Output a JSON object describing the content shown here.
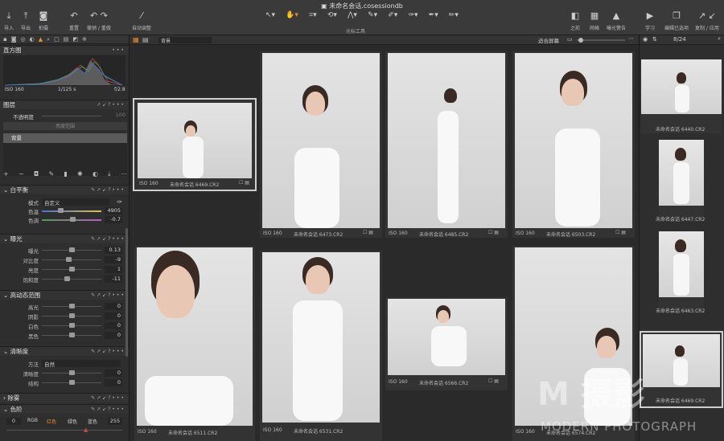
{
  "window": {
    "title": "未命名会话.cosessiondb"
  },
  "toolbar": {
    "import": "导入",
    "export": "导出",
    "capture": "拍摄",
    "reset": "重置",
    "undo_redo": "撤销 / 重做",
    "auto_adjust": "自动调整",
    "cursor_tools": "光标工具",
    "before": "之前",
    "grid": "网格",
    "exposure_warning": "曝光警告",
    "learn": "学习",
    "edit_selected": "编辑已选项",
    "copy_apply": "复制 / 应用"
  },
  "viewer": {
    "layer_select": "背景",
    "fit": "适合屏幕",
    "counter": "8/24"
  },
  "histogram": {
    "title": "直方图",
    "iso": "ISO 160",
    "shutter": "1/125 s",
    "aperture": "f/2.8"
  },
  "layers": {
    "title": "图层",
    "opacity_label": "不透明度",
    "opacity_value": "100",
    "mask_label": "亮度范围",
    "background_layer": "背景"
  },
  "white_balance": {
    "title": "白平衡",
    "mode_label": "模式",
    "mode_value": "自定义",
    "rows": [
      {
        "label": "色温",
        "value": "4905"
      },
      {
        "label": "色调",
        "value": "-0.7"
      }
    ]
  },
  "exposure": {
    "title": "曝光",
    "rows": [
      {
        "label": "曝光",
        "value": "0.13"
      },
      {
        "label": "对比度",
        "value": "-9"
      },
      {
        "label": "亮度",
        "value": "1"
      },
      {
        "label": "饱和度",
        "value": "-11"
      }
    ]
  },
  "hdr": {
    "title": "高动态范围",
    "rows": [
      {
        "label": "高光",
        "value": "0"
      },
      {
        "label": "阴影",
        "value": "0"
      },
      {
        "label": "白色",
        "value": "0"
      },
      {
        "label": "黑色",
        "value": "0"
      }
    ]
  },
  "clarity": {
    "title": "清晰度",
    "method_label": "方法",
    "method_value": "自然",
    "rows": [
      {
        "label": "清晰度",
        "value": "0"
      },
      {
        "label": "结构",
        "value": "0"
      }
    ]
  },
  "dehaze": {
    "title": "除雾"
  },
  "levels": {
    "title": "色阶",
    "low": "0",
    "high": "255",
    "channels": [
      "RGB",
      "红色",
      "绿色",
      "蓝色"
    ]
  },
  "thumbnails": [
    {
      "iso": "ISO 160",
      "name": "未命名会话 6469.CR2"
    },
    {
      "iso": "ISO 160",
      "name": "未命名会话 6473.CR2"
    },
    {
      "iso": "ISO 160",
      "name": "未命名会话 6485.CR2"
    },
    {
      "iso": "ISO 160",
      "name": "未命名会话 6503.CR2"
    },
    {
      "iso": "ISO 160",
      "name": "未命名会话 6511.CR2"
    },
    {
      "iso": "ISO 160",
      "name": "未命名会话 6531.CR2"
    },
    {
      "iso": "ISO 160",
      "name": "未命名会话 6566.CR2"
    },
    {
      "iso": "ISO 160",
      "name": "未命名会话 6574.CR2"
    }
  ],
  "filmstrip": [
    {
      "name": "未命名会话 6440.CR2"
    },
    {
      "name": "未命名会话 6447.CR2"
    },
    {
      "name": "未命名会话 6463.CR2"
    },
    {
      "name": "未命名会话 6469.CR2"
    }
  ],
  "watermark": {
    "logo": "M  摄影",
    "sub": "MODERN PHOTOGRAPH"
  },
  "colors": {
    "accent": "#f08a24",
    "panel": "#2e2e2e",
    "background": "#2a2a2a"
  }
}
